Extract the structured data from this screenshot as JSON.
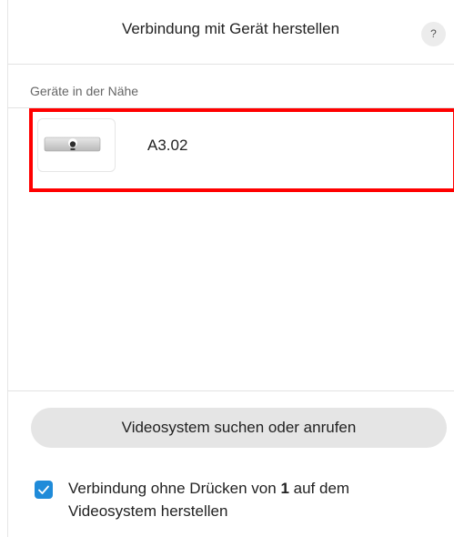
{
  "header": {
    "title": "Verbindung mit Gerät herstellen",
    "help_label": "?"
  },
  "nearby": {
    "section_label": "Geräte in der Nähe",
    "devices": [
      {
        "name": "A3.02",
        "icon": "camera-device-icon"
      }
    ]
  },
  "search": {
    "button_label": "Videosystem suchen oder anrufen"
  },
  "option": {
    "checked": true,
    "label_before": "Verbindung ohne Drücken von ",
    "label_bold": "1",
    "label_after": " auf dem Videosystem herstellen"
  },
  "colors": {
    "highlight": "#ff0000",
    "checkbox": "#1f8bd9",
    "button_bg": "#e5e5e5"
  }
}
